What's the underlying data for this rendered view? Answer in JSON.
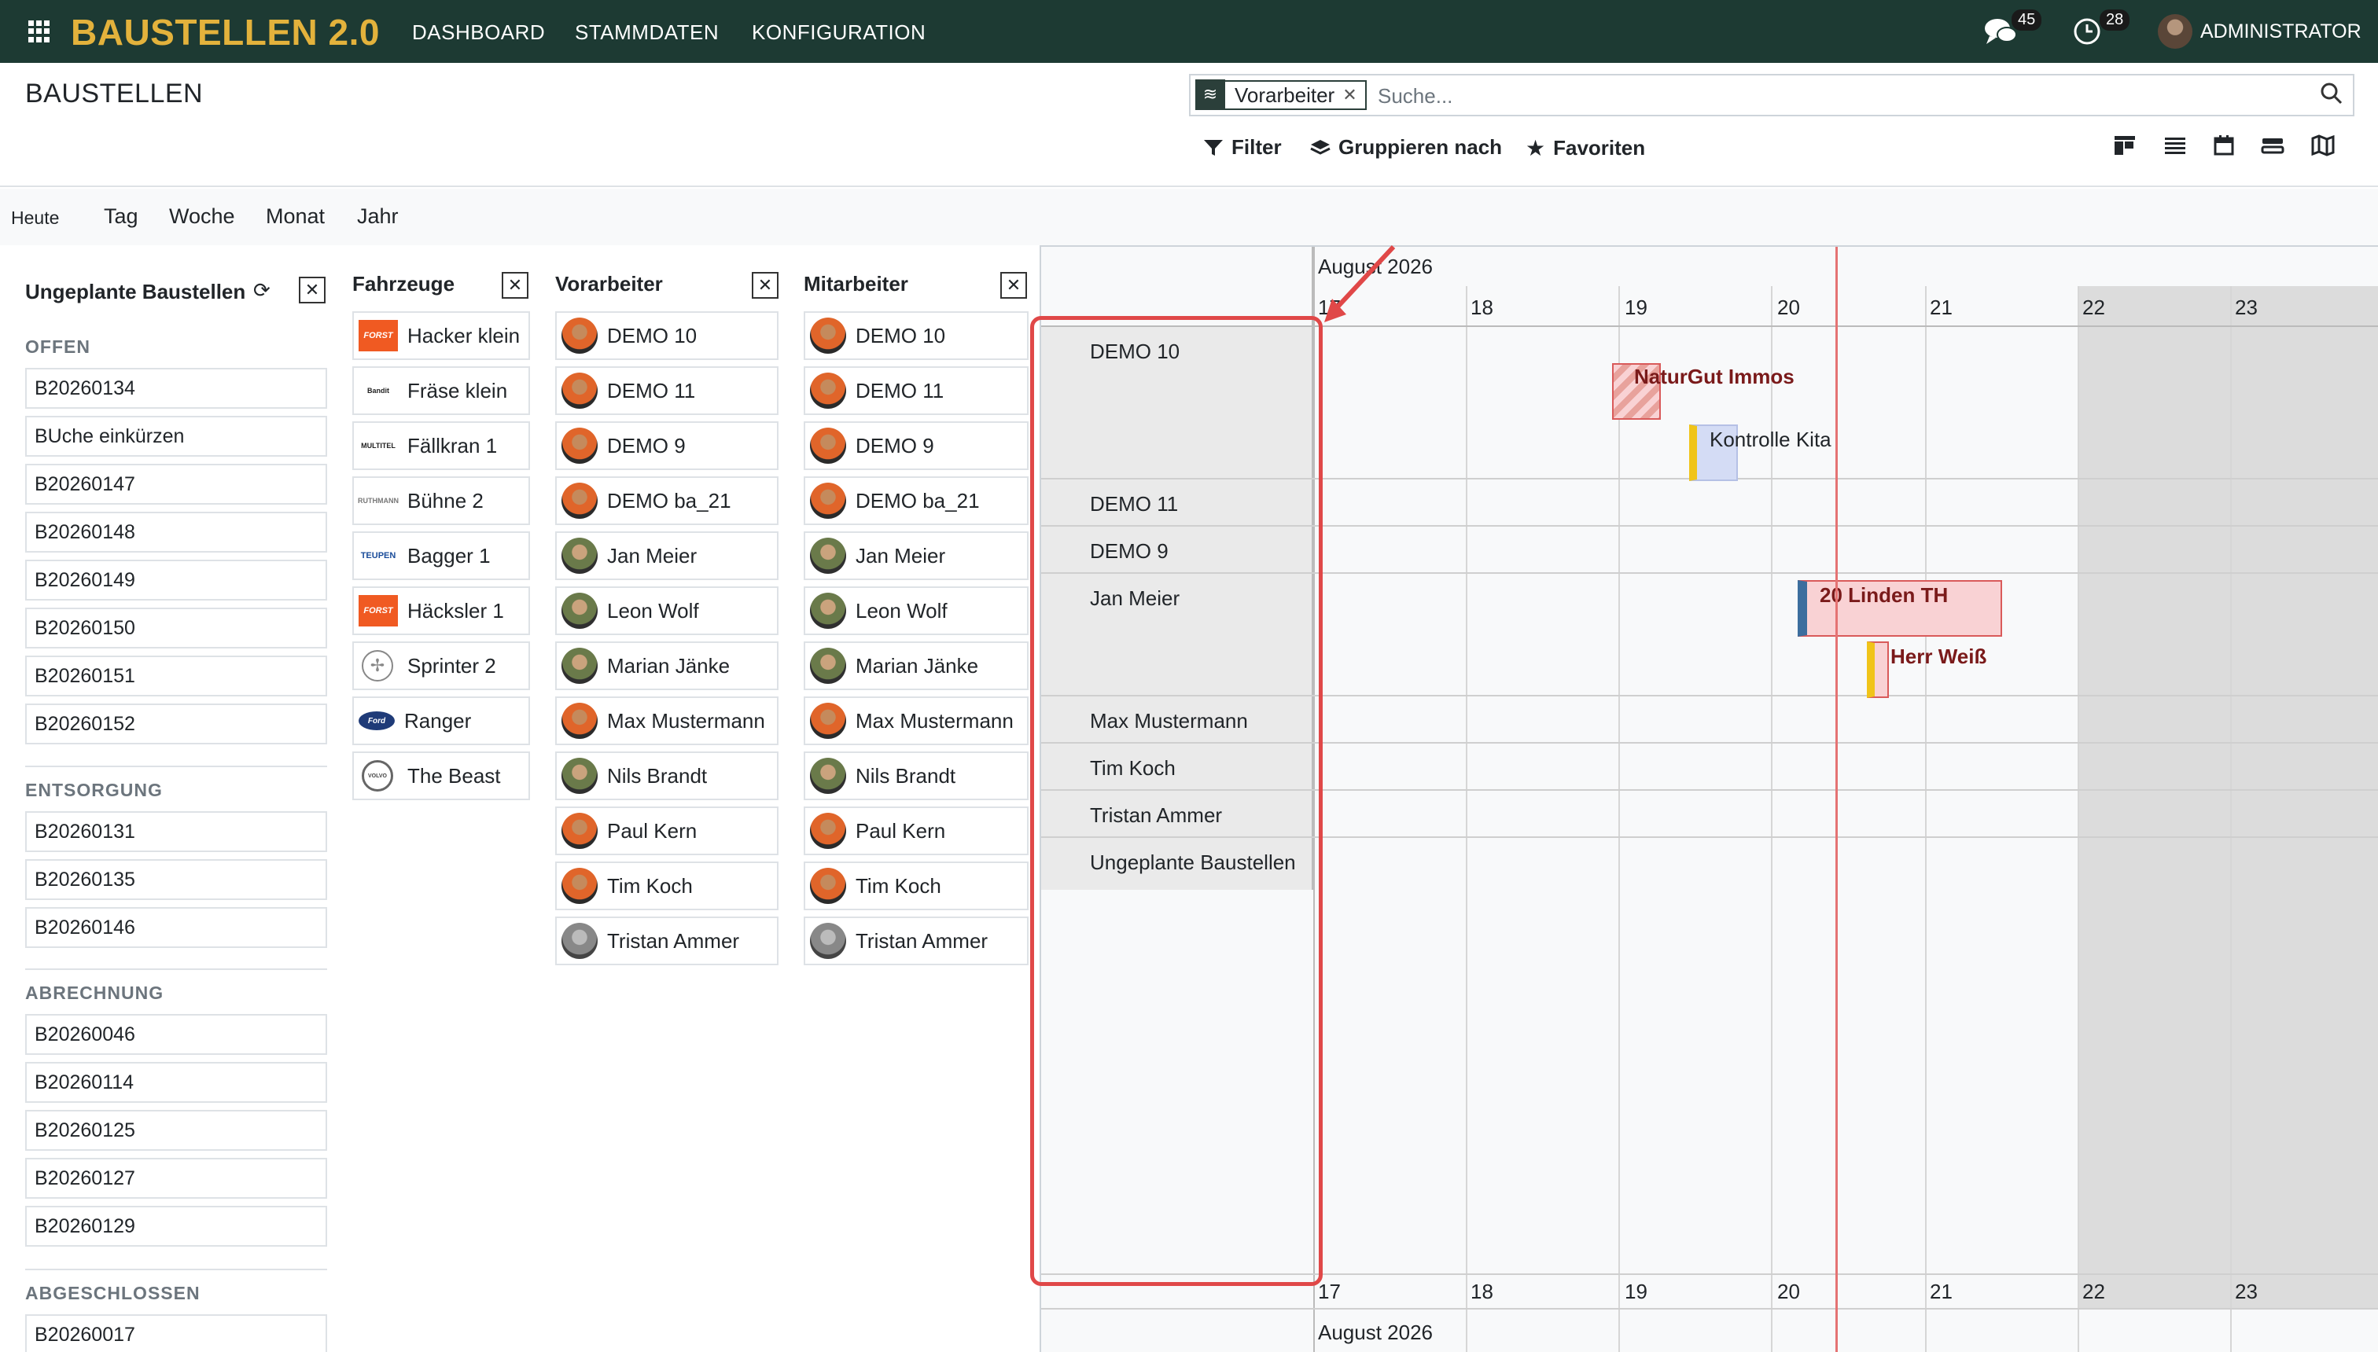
{
  "navbar": {
    "brand": "BAUSTELLEN 2.0",
    "menu": [
      "DASHBOARD",
      "STAMMDATEN",
      "KONFIGURATION"
    ],
    "messages_count": "45",
    "activities_count": "28",
    "user": "ADMINISTRATOR",
    "icons": [
      "apps-icon",
      "chat-icon",
      "clock-icon",
      "avatar"
    ]
  },
  "control_panel": {
    "title": "BAUSTELLEN",
    "facet_label": "Vorarbeiter",
    "search_placeholder": "Suche...",
    "filter_label": "Filter",
    "group_label": "Gruppieren nach",
    "favorites_label": "Favoriten",
    "views": [
      "kanban-view",
      "list-view",
      "calendar-view",
      "gantt-view",
      "map-view"
    ]
  },
  "scale": {
    "today": "Heute",
    "options": [
      "Tag",
      "Woche",
      "Monat",
      "Jahr"
    ]
  },
  "unplanned": {
    "title": "Ungeplante Baustellen",
    "groups": [
      {
        "name": "OFFEN",
        "items": [
          "B20260134",
          "BUche einkürzen",
          "B20260147",
          "B20260148",
          "B20260149",
          "B20260150",
          "B20260151",
          "B20260152"
        ]
      },
      {
        "name": "ENTSORGUNG",
        "items": [
          "B20260131",
          "B20260135",
          "B20260146"
        ]
      },
      {
        "name": "ABRECHNUNG",
        "items": [
          "B20260046",
          "B20260114",
          "B20260125",
          "B20260127",
          "B20260129"
        ]
      },
      {
        "name": "ABGESCHLOSSEN",
        "items": [
          "B20260017"
        ]
      }
    ]
  },
  "vehicles": {
    "title": "Fahrzeuge",
    "items": [
      {
        "name": "Hacker klein",
        "logo": "FORST"
      },
      {
        "name": "Fräse klein",
        "logo": "Bandit"
      },
      {
        "name": "Fällkran 1",
        "logo": "MULTITEL"
      },
      {
        "name": "Bühne 2",
        "logo": "RUTHMANN"
      },
      {
        "name": "Bagger 1",
        "logo": "TEUPEN"
      },
      {
        "name": "Häcksler 1",
        "logo": "FORST"
      },
      {
        "name": "Sprinter 2",
        "logo": "mercedes-icon"
      },
      {
        "name": "Ranger",
        "logo": "Ford"
      },
      {
        "name": "The Beast",
        "logo": "VOLVO"
      }
    ]
  },
  "foremen": {
    "title": "Vorarbeiter",
    "items": [
      "DEMO 10",
      "DEMO 11",
      "DEMO 9",
      "DEMO ba_21",
      "Jan Meier",
      "Leon Wolf",
      "Marian Jänke",
      "Max Mustermann",
      "Nils Brandt",
      "Paul Kern",
      "Tim Koch",
      "Tristan Ammer"
    ]
  },
  "workers": {
    "title": "Mitarbeiter",
    "items": [
      "DEMO 10",
      "DEMO 11",
      "DEMO 9",
      "DEMO ba_21",
      "Jan Meier",
      "Leon Wolf",
      "Marian Jänke",
      "Max Mustermann",
      "Nils Brandt",
      "Paul Kern",
      "Tim Koch",
      "Tristan Ammer"
    ]
  },
  "gantt": {
    "month": "August 2026",
    "days": [
      "17",
      "18",
      "19",
      "20",
      "21",
      "22",
      "23"
    ],
    "weekend_days": [
      "22",
      "23"
    ],
    "rows": [
      "DEMO 10",
      "DEMO 11",
      "DEMO 9",
      "Jan Meier",
      "Max Mustermann",
      "Tim Koch",
      "Tristan Ammer",
      "Ungeplante Baustellen"
    ],
    "tasks": [
      {
        "name": "NaturGut Immos",
        "row": "DEMO 10",
        "start_day": "19",
        "color": "#f9d2d4"
      },
      {
        "name": "Kontrolle Kita",
        "row": "DEMO 10",
        "start_day": "19",
        "color": "#d4dcf5"
      },
      {
        "name": "20 Linden TH",
        "row": "Jan Meier",
        "start_day": "20",
        "color": "#f9d2d4"
      },
      {
        "name": "Herr Weiß",
        "row": "Jan Meier",
        "start_day": "20",
        "color": "#f9d2d4"
      }
    ],
    "today_marker_color": "#e57373"
  },
  "annotation_color": "#e04848"
}
